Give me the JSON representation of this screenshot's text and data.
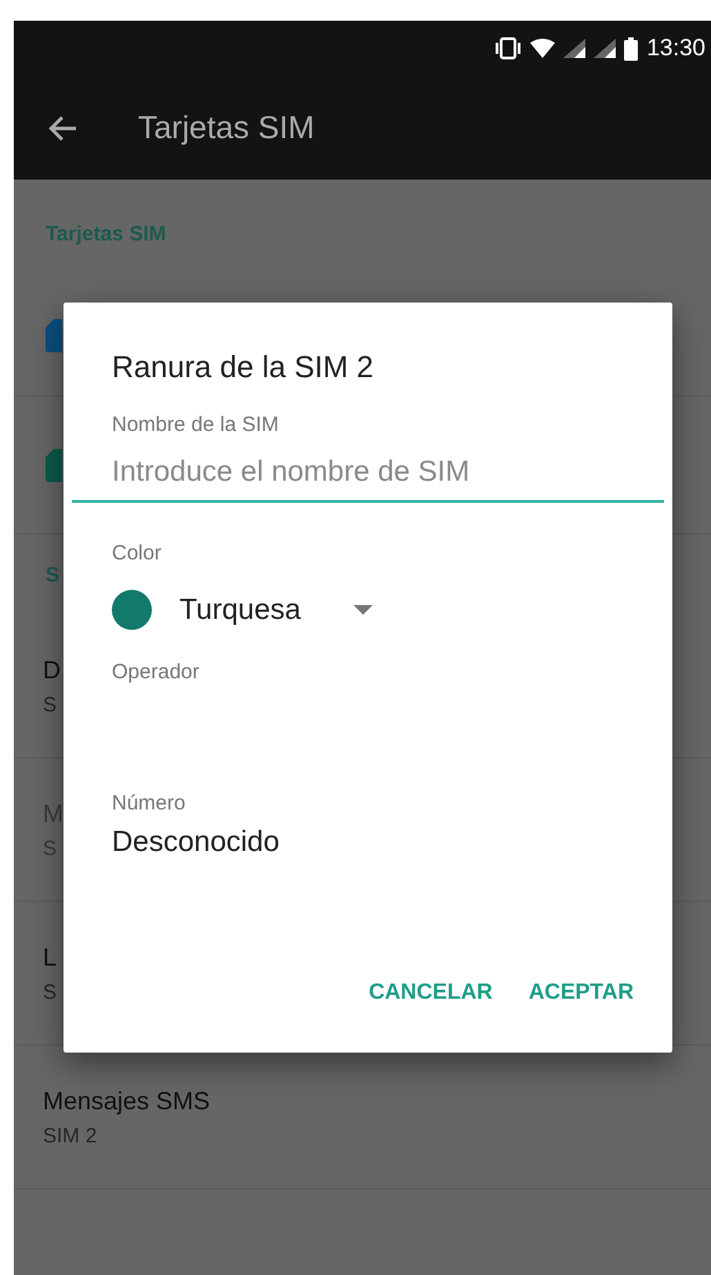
{
  "status_bar": {
    "time": "13:30"
  },
  "toolbar": {
    "title": "Tarjetas SIM"
  },
  "sections": [
    {
      "header": "Tarjetas SIM",
      "rows": [
        {
          "kind": "sim",
          "color": "#0b4f80"
        },
        {
          "kind": "sim",
          "color": "#0b5a4c"
        }
      ]
    },
    {
      "header": "S",
      "rows": [
        {
          "kind": "setting",
          "title": "D",
          "subtitle": "S",
          "disabled": false
        },
        {
          "kind": "setting",
          "title": "M",
          "subtitle": "S",
          "disabled": true
        },
        {
          "kind": "setting",
          "title": "L",
          "subtitle": "S",
          "disabled": false
        },
        {
          "kind": "setting",
          "title": "Mensajes SMS",
          "subtitle": "SIM 2",
          "disabled": false
        }
      ]
    }
  ],
  "dialog": {
    "title": "Ranura de la SIM 2",
    "name_label": "Nombre de la SIM",
    "name_placeholder": "Introduce el nombre de SIM",
    "color_label": "Color",
    "color": {
      "name": "Turquesa",
      "color": "#137a6b"
    },
    "operator_label": "Operador",
    "number_label": "Número",
    "number_value": "Desconocido",
    "buttons": [
      "CANCELAR",
      "ACEPTAR"
    ]
  }
}
